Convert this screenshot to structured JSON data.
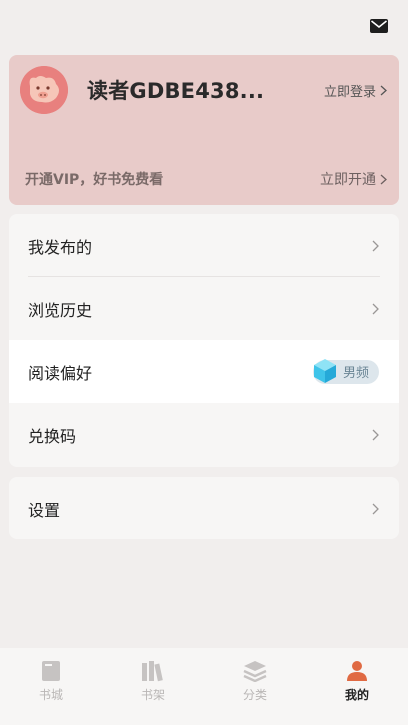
{
  "header": {
    "mail_icon": "mail-icon"
  },
  "user": {
    "name": "读者GDBE438...",
    "login_label": "立即登录",
    "avatar_icon": "pig-avatar-icon"
  },
  "vip": {
    "promo_text": "开通VIP，好书免费看",
    "action_label": "立即开通"
  },
  "menu": {
    "published": "我发布的",
    "history": "浏览历史",
    "preference": "阅读偏好",
    "preference_value": "男频",
    "redeem": "兑换码",
    "settings": "设置"
  },
  "tabs": [
    {
      "label": "书城",
      "icon": "book-icon",
      "active": false
    },
    {
      "label": "书架",
      "icon": "bookshelf-icon",
      "active": false
    },
    {
      "label": "分类",
      "icon": "layers-icon",
      "active": false
    },
    {
      "label": "我的",
      "icon": "user-icon",
      "active": true
    }
  ],
  "colors": {
    "card_bg": "#e8cbc9",
    "accent": "#e06a43",
    "avatar_bg": "#e8807e"
  }
}
